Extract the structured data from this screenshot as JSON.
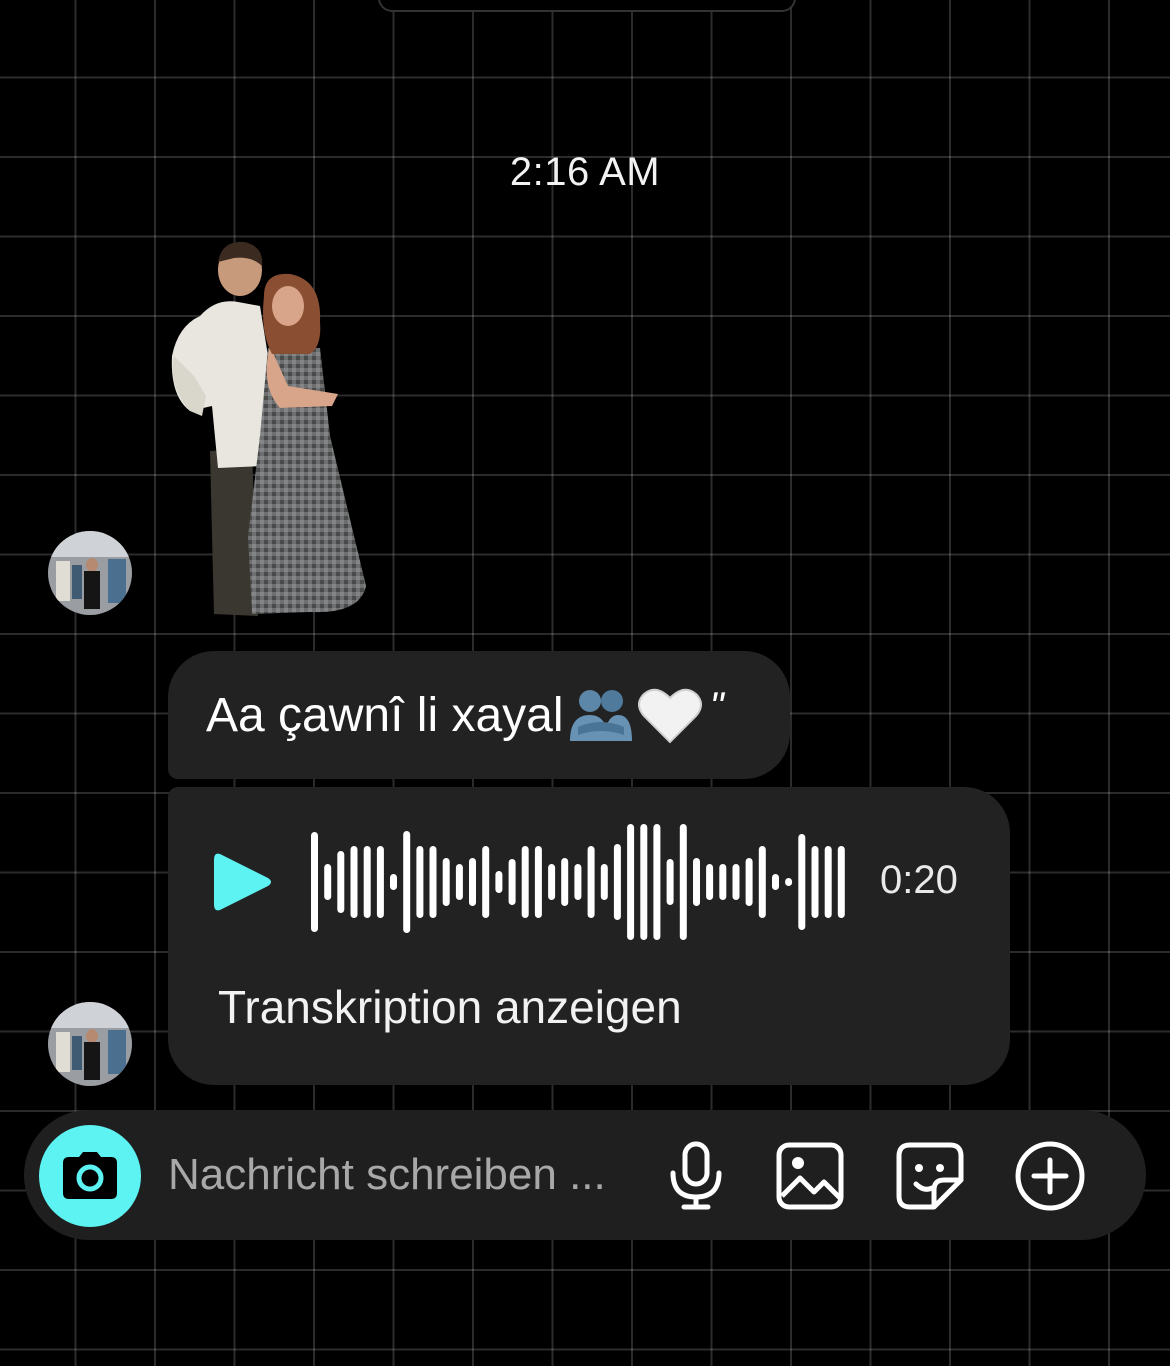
{
  "conversation": {
    "timestamp": "2:16 AM"
  },
  "messages": {
    "text_message": {
      "text": "Aa çawnî li xayal",
      "emoji_1": "people-hugging",
      "emoji_2": "🤍",
      "suffix": "\""
    },
    "voice_message": {
      "duration": "0:20",
      "transcript_label": "Transkription anzeigen",
      "play_icon": "play-icon"
    }
  },
  "composer": {
    "placeholder": "Nachricht schreiben ...",
    "value": "",
    "icons": [
      "camera-icon",
      "microphone-icon",
      "gallery-icon",
      "sticker-icon",
      "plus-circle-icon"
    ]
  },
  "colors": {
    "accent": "#5ef3f3",
    "bubble": "#222222",
    "composer": "#1f1f1f",
    "background": "#000000",
    "grid": "#2b2b2b"
  }
}
